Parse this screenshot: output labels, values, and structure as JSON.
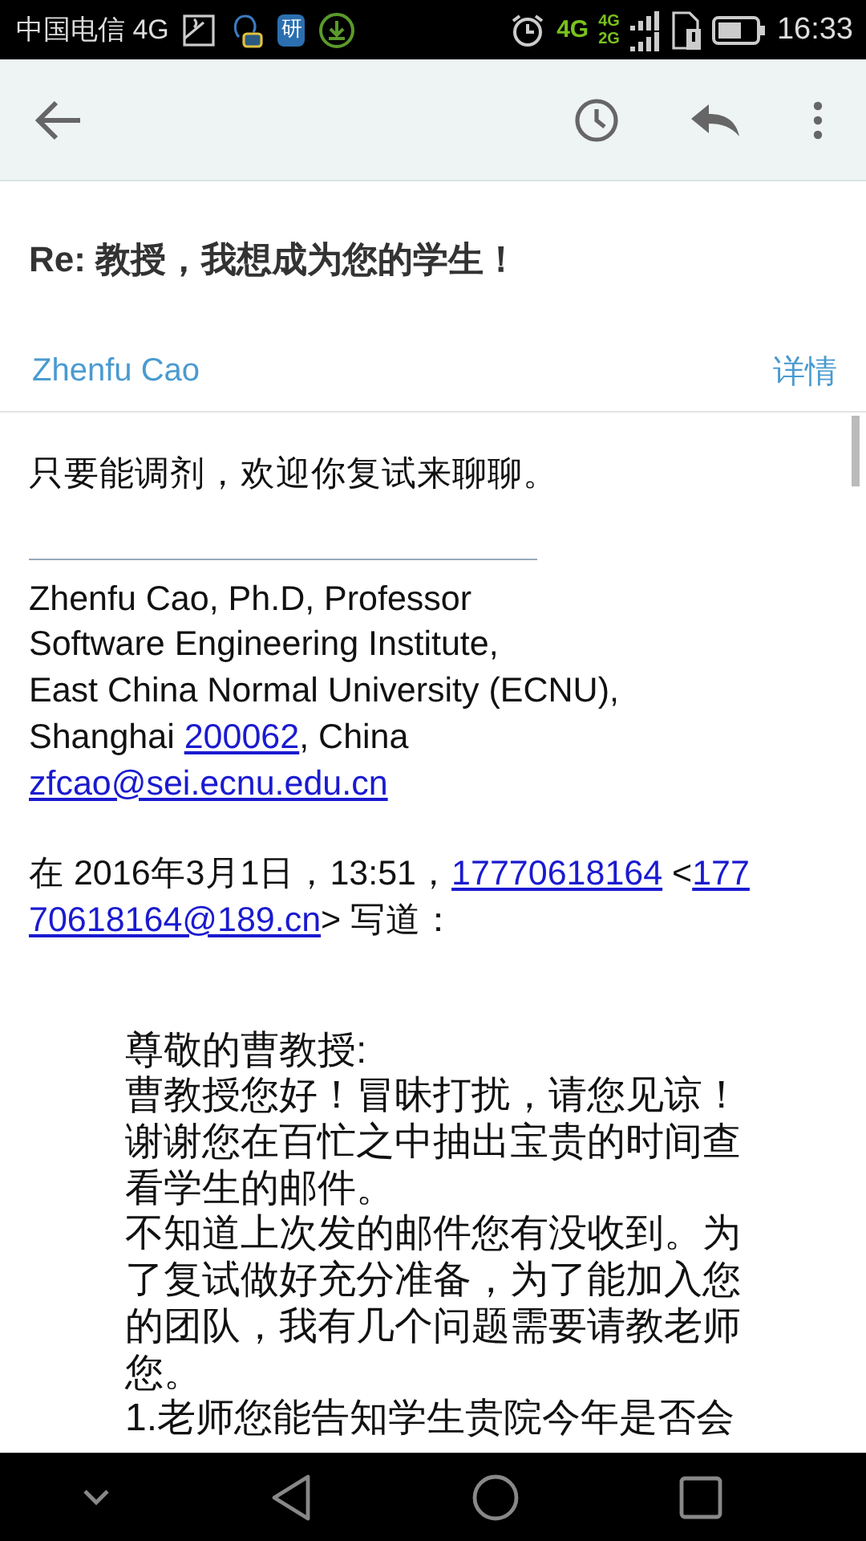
{
  "status_bar": {
    "carrier": "中国电信 4G",
    "app_badge": "研",
    "network": "4G",
    "sim_1": "4G",
    "sim_2": "2G",
    "time": "16:33"
  },
  "subject": "Re: 教授，我想成为您的学生！",
  "sender": {
    "name": "Zhenfu Cao",
    "details": "详情"
  },
  "body": {
    "reply": "只要能调剂，欢迎你复试来聊聊。",
    "signature": [
      {
        "text": "Zhenfu Cao, Ph.D, Professor"
      },
      {
        "text": "Software Engineering Institute,"
      },
      {
        "text": "East China Normal University (ECNU),"
      },
      {
        "text": "Shanghai ",
        "link": "200062",
        "after": ", China"
      },
      {
        "link": "zfcao@sei.ecnu.edu.cn"
      }
    ],
    "attribution": {
      "before": "在 2016年3月1日，13:51，",
      "phone": "17770618164",
      "middle": " <",
      "email_lines": [
        "177",
        "70618164@189.cn"
      ],
      "after": "> 写道："
    },
    "quote": [
      "尊敬的曹教授:",
      "曹教授您好！冒昧打扰，请您见谅！谢谢您在百忙之中抽出宝贵的时间查看学生的邮件。",
      "不知道上次发的邮件您有没收到。为了复试做好充分准备，为了能加入您的团队，我有几个问题需要请教老师您。",
      "1.老师您能告知学生贵院今年是否会"
    ]
  }
}
